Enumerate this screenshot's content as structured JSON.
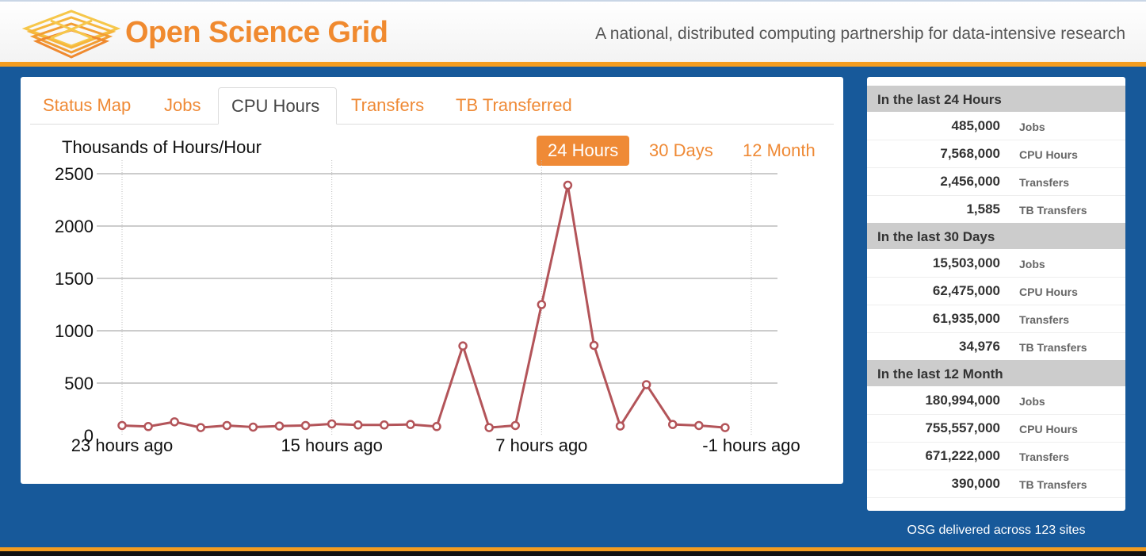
{
  "header": {
    "brand": "Open Science Grid",
    "tagline": "A national, distributed computing partnership for data-intensive research",
    "logo_icon": "osg-logo-icon",
    "brand_color": "#f08a2f",
    "accent_color": "#f39c1f",
    "background_color": "#17599a"
  },
  "tabs": [
    {
      "label": "Status Map",
      "active": false
    },
    {
      "label": "Jobs",
      "active": false
    },
    {
      "label": "CPU Hours",
      "active": true
    },
    {
      "label": "Transfers",
      "active": false
    },
    {
      "label": "TB Transferred",
      "active": false
    }
  ],
  "range_buttons": [
    {
      "label": "24 Hours",
      "active": true
    },
    {
      "label": "30 Days",
      "active": false
    },
    {
      "label": "12 Month",
      "active": false
    }
  ],
  "chart_data": {
    "type": "line",
    "ylabel": "Thousands of Hours/Hour",
    "ylim": [
      0,
      2500
    ],
    "yticks": [
      0,
      500,
      1000,
      1500,
      2000,
      2500
    ],
    "ytick_labels": [
      "0",
      "500",
      "1000",
      "1500",
      "2000",
      "2500"
    ],
    "xticks": [
      -23,
      -15,
      -7,
      1
    ],
    "xtick_labels": [
      "23 hours ago",
      "15 hours ago",
      "7 hours ago",
      "-1 hours ago"
    ],
    "grid": true,
    "line_color": "#b35459",
    "series": [
      {
        "x": [
          -23,
          -22,
          -21,
          -20,
          -19,
          -18,
          -17,
          -16,
          -15,
          -14,
          -13,
          -12,
          -11,
          -10,
          -9,
          -8,
          -7,
          -6,
          -5,
          -4,
          -3,
          -2,
          -1,
          0
        ],
        "values": [
          95,
          85,
          130,
          75,
          95,
          80,
          90,
          95,
          110,
          100,
          100,
          105,
          85,
          855,
          75,
          95,
          1250,
          2390,
          860,
          90,
          485,
          105,
          95,
          75
        ]
      }
    ]
  },
  "stats": [
    {
      "heading": "In the last 24 Hours",
      "rows": [
        {
          "value": "485,000",
          "label": "Jobs"
        },
        {
          "value": "7,568,000",
          "label": "CPU Hours"
        },
        {
          "value": "2,456,000",
          "label": "Transfers"
        },
        {
          "value": "1,585",
          "label": "TB Transfers"
        }
      ]
    },
    {
      "heading": "In the last 30 Days",
      "rows": [
        {
          "value": "15,503,000",
          "label": "Jobs"
        },
        {
          "value": "62,475,000",
          "label": "CPU Hours"
        },
        {
          "value": "61,935,000",
          "label": "Transfers"
        },
        {
          "value": "34,976",
          "label": "TB Transfers"
        }
      ]
    },
    {
      "heading": "In the last 12 Month",
      "rows": [
        {
          "value": "180,994,000",
          "label": "Jobs"
        },
        {
          "value": "755,557,000",
          "label": "CPU Hours"
        },
        {
          "value": "671,222,000",
          "label": "Transfers"
        },
        {
          "value": "390,000",
          "label": "TB Transfers"
        }
      ]
    }
  ],
  "footer": {
    "sites_text": "OSG delivered across 123 sites"
  }
}
